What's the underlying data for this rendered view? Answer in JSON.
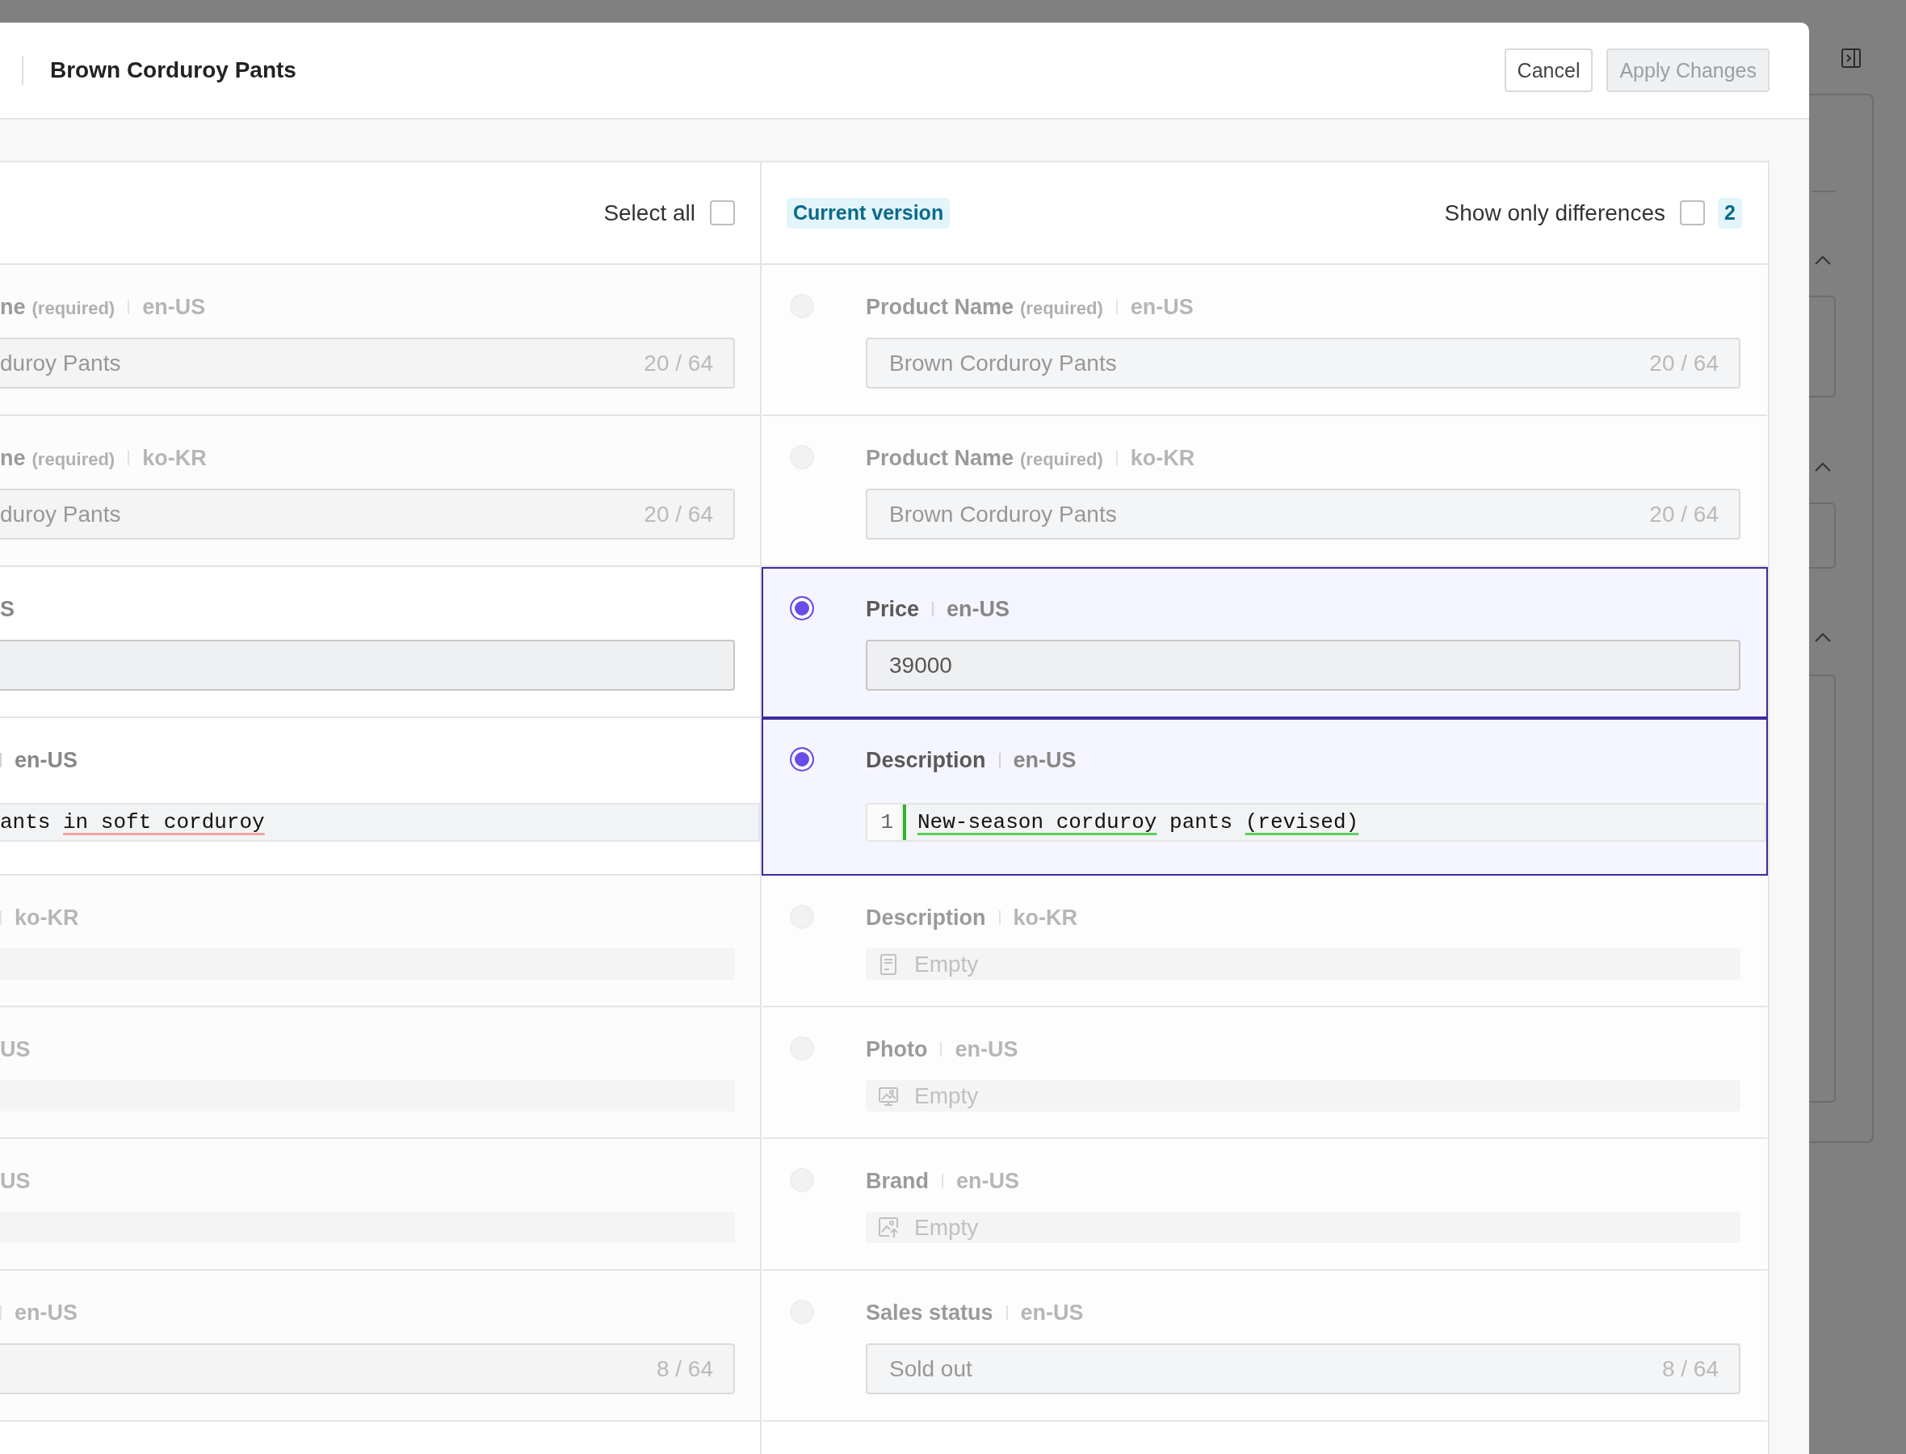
{
  "dialog": {
    "title": "Brown Corduroy Pants",
    "buttons": [
      {
        "label": "Cancel",
        "kind": "secondary",
        "disabled": false
      },
      {
        "label": "Apply Changes",
        "kind": "primary",
        "disabled": true
      }
    ]
  },
  "comparison": {
    "previous": {
      "select_all": {
        "label": "Select all",
        "checked": false
      },
      "rows": [
        {
          "disabled": true,
          "label": [
            {
              "kind": "name",
              "text": "ne"
            },
            {
              "kind": "note",
              "text": "(required)"
            },
            {
              "kind": "divider"
            },
            {
              "kind": "locale",
              "text": "en-US"
            }
          ],
          "field": {
            "kind": "text",
            "value": "duroy Pants",
            "counter": "20 / 64"
          }
        },
        {
          "disabled": true,
          "label": [
            {
              "kind": "name",
              "text": "ne"
            },
            {
              "kind": "note",
              "text": "(required)"
            },
            {
              "kind": "divider"
            },
            {
              "kind": "locale",
              "text": "ko-KR"
            }
          ],
          "field": {
            "kind": "text",
            "value": "duroy Pants",
            "counter": "20 / 64"
          }
        },
        {
          "disabled": false,
          "label": [
            {
              "kind": "locale",
              "text": "S"
            }
          ],
          "field": {
            "kind": "text"
          }
        },
        {
          "disabled": false,
          "label": [
            {
              "kind": "divider"
            },
            {
              "kind": "locale",
              "text": "en-US"
            }
          ],
          "field": {
            "kind": "code",
            "segments": [
              {
                "text": "ants ",
                "kind": "plain"
              },
              {
                "text": "in soft corduroy",
                "kind": "removed"
              }
            ]
          }
        },
        {
          "disabled": true,
          "label": [
            {
              "kind": "divider"
            },
            {
              "kind": "locale",
              "text": "ko-KR"
            }
          ],
          "field": {
            "kind": "blank"
          }
        },
        {
          "disabled": true,
          "label": [
            {
              "kind": "locale",
              "text": "US"
            }
          ],
          "field": {
            "kind": "blank"
          }
        },
        {
          "disabled": true,
          "label": [
            {
              "kind": "locale",
              "text": "US"
            }
          ],
          "field": {
            "kind": "blank"
          }
        },
        {
          "disabled": true,
          "label": [
            {
              "kind": "divider"
            },
            {
              "kind": "locale",
              "text": "en-US"
            }
          ],
          "field": {
            "kind": "text",
            "counter": "8 / 64"
          }
        }
      ]
    },
    "current": {
      "badge": "Current version",
      "show_only_differences": {
        "label": "Show only differences",
        "checked": false
      },
      "difference_count": "2",
      "rows": [
        {
          "selected": false,
          "disabled": true,
          "label": [
            {
              "kind": "name",
              "text": "Product Name"
            },
            {
              "kind": "note",
              "text": "(required)"
            },
            {
              "kind": "divider"
            },
            {
              "kind": "locale",
              "text": "en-US"
            }
          ],
          "field": {
            "kind": "text",
            "value": "Brown Corduroy Pants",
            "counter": "20 / 64"
          }
        },
        {
          "selected": false,
          "disabled": true,
          "label": [
            {
              "kind": "name",
              "text": "Product Name"
            },
            {
              "kind": "note",
              "text": "(required)"
            },
            {
              "kind": "divider"
            },
            {
              "kind": "locale",
              "text": "ko-KR"
            }
          ],
          "field": {
            "kind": "text",
            "value": "Brown Corduroy Pants",
            "counter": "20 / 64"
          }
        },
        {
          "selected": true,
          "disabled": false,
          "label": [
            {
              "kind": "name",
              "text": "Price"
            },
            {
              "kind": "divider"
            },
            {
              "kind": "locale",
              "text": "en-US"
            }
          ],
          "field": {
            "kind": "text",
            "value": "39000"
          }
        },
        {
          "selected": true,
          "disabled": false,
          "label": [
            {
              "kind": "name",
              "text": "Description"
            },
            {
              "kind": "divider"
            },
            {
              "kind": "locale",
              "text": "en-US"
            }
          ],
          "field": {
            "kind": "code",
            "line_number": "1",
            "changed": true,
            "segments": [
              {
                "text": "New-season corduroy",
                "kind": "added"
              },
              {
                "text": " pants ",
                "kind": "plain"
              },
              {
                "text": "(revised)",
                "kind": "added"
              }
            ]
          }
        },
        {
          "selected": false,
          "disabled": true,
          "label": [
            {
              "kind": "name",
              "text": "Description"
            },
            {
              "kind": "divider"
            },
            {
              "kind": "locale",
              "text": "ko-KR"
            }
          ],
          "field": {
            "kind": "document",
            "empty_text": "Empty"
          }
        },
        {
          "selected": false,
          "disabled": true,
          "label": [
            {
              "kind": "name",
              "text": "Photo"
            },
            {
              "kind": "divider"
            },
            {
              "kind": "locale",
              "text": "en-US"
            }
          ],
          "field": {
            "kind": "image",
            "empty_text": "Empty"
          }
        },
        {
          "selected": false,
          "disabled": true,
          "label": [
            {
              "kind": "name",
              "text": "Brand"
            },
            {
              "kind": "divider"
            },
            {
              "kind": "locale",
              "text": "en-US"
            }
          ],
          "field": {
            "kind": "image_upload",
            "empty_text": "Empty"
          }
        },
        {
          "selected": false,
          "disabled": true,
          "label": [
            {
              "kind": "name",
              "text": "Sales status"
            },
            {
              "kind": "divider"
            },
            {
              "kind": "locale",
              "text": "en-US"
            }
          ],
          "field": {
            "kind": "text",
            "value": "Sold out",
            "counter": "8 / 64"
          }
        }
      ]
    }
  }
}
